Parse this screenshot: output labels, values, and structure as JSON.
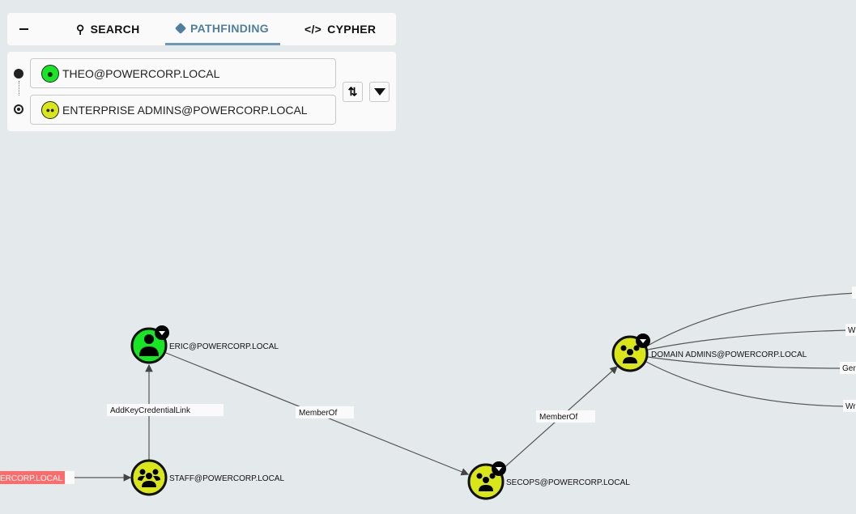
{
  "tabs": {
    "collapse_icon": "minus-icon",
    "search": "SEARCH",
    "pathfinding": "PATHFINDING",
    "cypher": "CYPHER",
    "active": "pathfinding"
  },
  "pathfinding": {
    "source": "THEO@POWERCORP.LOCAL",
    "target": "ENTERPRISE ADMINS@POWERCORP.LOCAL",
    "swap_icon": "swap-vertical-icon",
    "filter_icon": "filter-icon"
  },
  "graph": {
    "nodes": {
      "eric": "ERIC@POWERCORP.LOCAL",
      "staff": "STAFF@POWERCORP.LOCAL",
      "secops": "SECOPS@POWERCORP.LOCAL",
      "domain_admins": "DOMAIN ADMINS@POWERCORP.LOCAL",
      "left_partial": "ERCORP.LOCAL"
    },
    "edges": {
      "staff_eric": "AddKeyCredentialLink",
      "eric_secops": "MemberOf",
      "secops_da": "MemberOf",
      "da_1": "",
      "da_2": "W",
      "da_3": "Ger",
      "da_4": "Wr"
    },
    "colors": {
      "user": "#17e625",
      "group": "#dbe617",
      "highlight": "#ff6b6b"
    }
  }
}
